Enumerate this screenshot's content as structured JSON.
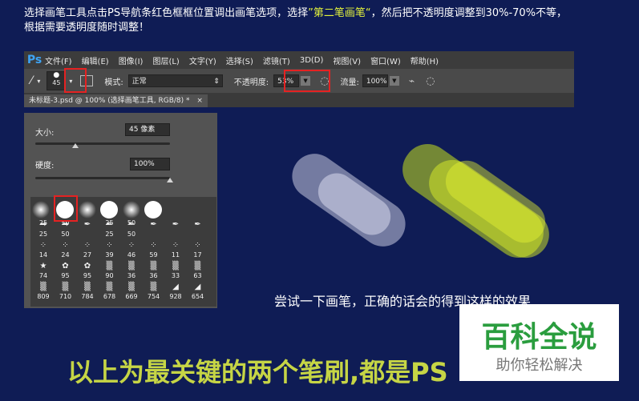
{
  "intro": {
    "part1": "选择画笔工具点击PS导航条红色框框位置调出画笔选项，选择",
    "highlight": "”第二笔画笔“",
    "part2": "，然后把不透明度调整到30%-70%不等，",
    "line2": "根据需要透明度随时调整！"
  },
  "photoshop": {
    "logo": "Ps",
    "menus": [
      "文件(F)",
      "编辑(E)",
      "图像(I)",
      "图层(L)",
      "文字(Y)",
      "选择(S)",
      "滤镜(T)",
      "3D(D)",
      "视图(V)",
      "窗口(W)",
      "帮助(H)"
    ],
    "options": {
      "brush_size": "45",
      "mode_label": "模式:",
      "mode_value": "正常",
      "opacity_label": "不透明度:",
      "opacity_value": "53%",
      "flow_label": "流量:",
      "flow_value": "100%"
    },
    "doc_tab": "未标题-3.psd @ 100% (选择画笔工具, RGB/8) *",
    "doc_tab_close": "×"
  },
  "brush_panel": {
    "size_label": "大小:",
    "size_value": "45 像素",
    "size_level": 0.3,
    "hardness_label": "硬度:",
    "hardness_value": "100%",
    "hardness_level": 1.0,
    "rows": [
      [
        {
          "g": "",
          "n": "25"
        },
        {
          "g": "",
          "n": "50"
        },
        {
          "g": "",
          "n": ""
        },
        {
          "g": "",
          "n": "25"
        },
        {
          "g": "",
          "n": "50"
        },
        {
          "g": "",
          "n": ""
        },
        {
          "g": "",
          "n": ""
        },
        {
          "g": "",
          "n": ""
        }
      ],
      [
        {
          "g": "➡",
          "n": "25"
        },
        {
          "g": "➡",
          "n": "50"
        },
        {
          "g": "✒",
          "n": ""
        },
        {
          "g": "✒",
          "n": "25"
        },
        {
          "g": "✒",
          "n": "50"
        },
        {
          "g": "✒",
          "n": ""
        },
        {
          "g": "✒",
          "n": ""
        },
        {
          "g": "✒",
          "n": ""
        }
      ],
      [
        {
          "g": "⁘",
          "n": "14"
        },
        {
          "g": "⁘",
          "n": "24"
        },
        {
          "g": "⁘",
          "n": "27"
        },
        {
          "g": "⁘",
          "n": "39"
        },
        {
          "g": "⁘",
          "n": "46"
        },
        {
          "g": "⁘",
          "n": "59"
        },
        {
          "g": "⁘",
          "n": "11"
        },
        {
          "g": "⁘",
          "n": "17"
        }
      ],
      [
        {
          "g": "★",
          "n": "74"
        },
        {
          "g": "✿",
          "n": "95"
        },
        {
          "g": "✿",
          "n": "95"
        },
        {
          "g": "▒",
          "n": "90"
        },
        {
          "g": "▒",
          "n": "36"
        },
        {
          "g": "▒",
          "n": "36"
        },
        {
          "g": "▒",
          "n": "33"
        },
        {
          "g": "▒",
          "n": "63"
        }
      ],
      [
        {
          "g": "▒",
          "n": "809"
        },
        {
          "g": "▒",
          "n": "710"
        },
        {
          "g": "▒",
          "n": "784"
        },
        {
          "g": "▒",
          "n": "678"
        },
        {
          "g": "▒",
          "n": "669"
        },
        {
          "g": "▒",
          "n": "754"
        },
        {
          "g": "◢",
          "n": "928"
        },
        {
          "g": "◢",
          "n": "654"
        }
      ]
    ]
  },
  "caption": "尝试一下画笔，正确的话会的得到这样的效果",
  "bottom_text": "以上为最关键的两个笔刷,都是PS",
  "watermark": {
    "title": "百科全说",
    "subtitle": "助你轻松解决"
  }
}
